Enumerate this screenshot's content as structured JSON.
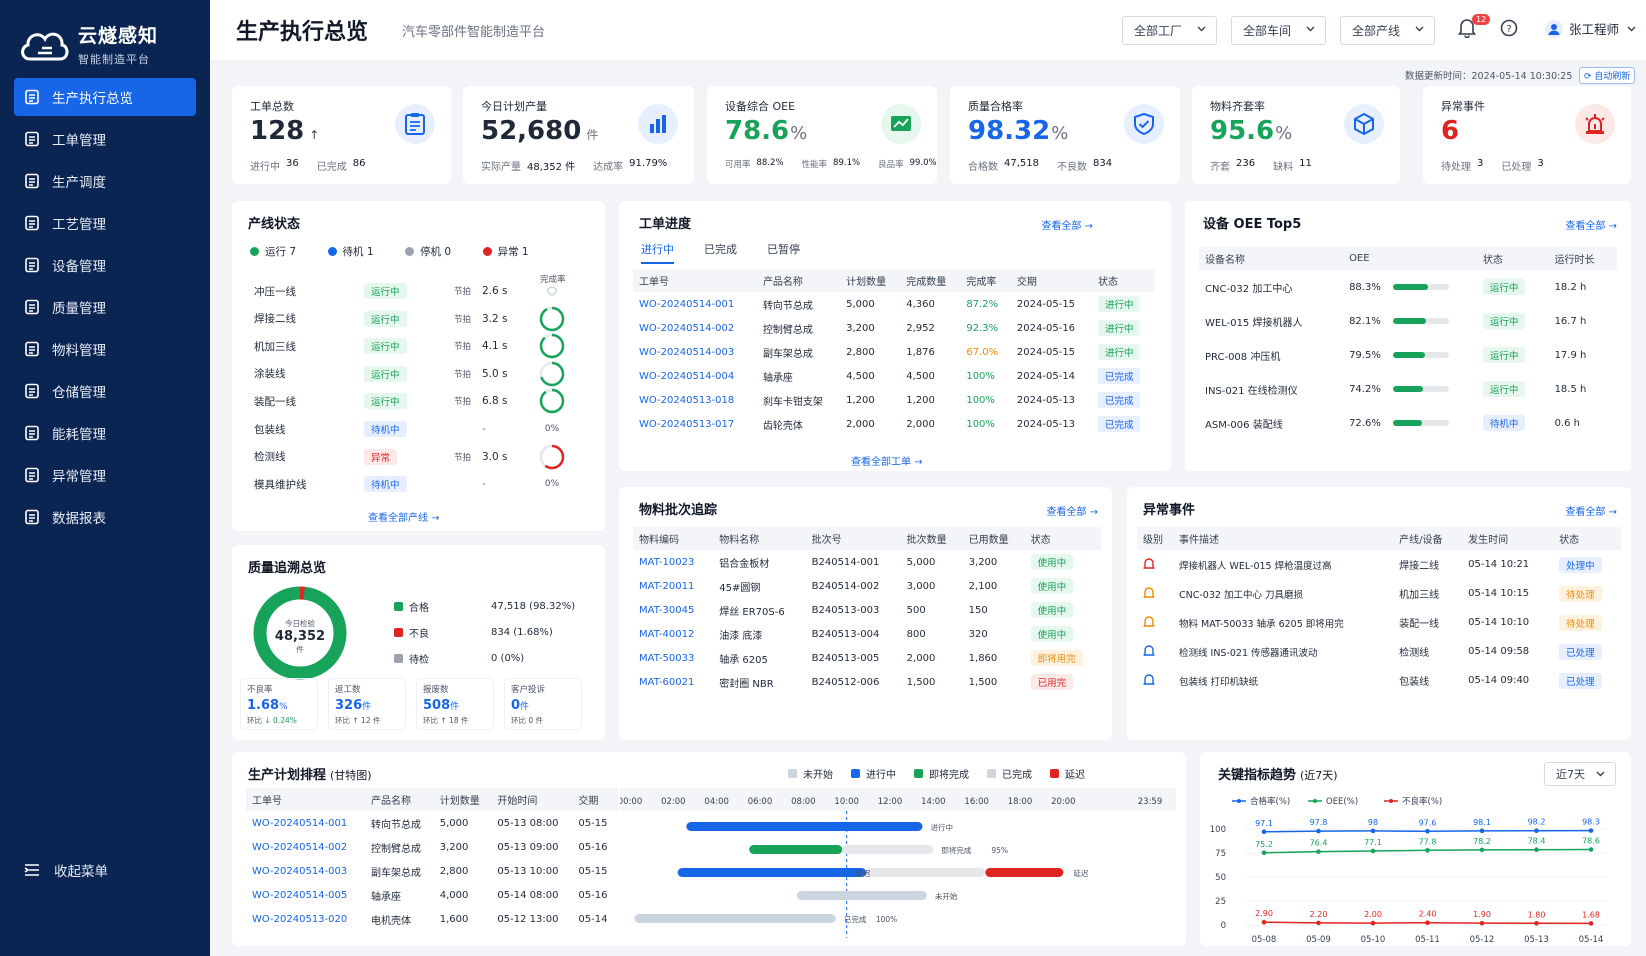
{
  "app": {
    "name": "云燧感知",
    "subtitle": "智能制造平台"
  },
  "nav": [
    {
      "label": "生产执行总览",
      "active": true
    },
    {
      "label": "工单管理"
    },
    {
      "label": "生产调度"
    },
    {
      "label": "工艺管理"
    },
    {
      "label": "设备管理"
    },
    {
      "label": "质量管理"
    },
    {
      "label": "物料管理"
    },
    {
      "label": "仓储管理"
    },
    {
      "label": "能耗管理"
    },
    {
      "label": "异常管理"
    },
    {
      "label": "数据报表"
    }
  ],
  "collapse_label": "收起菜单",
  "header": {
    "title": "生产执行总览",
    "subtitle": "汽车零部件智能制造平台",
    "factory": "全部工厂",
    "workshop": "全部车间",
    "line": "全部产线",
    "notif_count": "12",
    "user": "张工程师"
  },
  "meta": {
    "updated": "数据更新时间：2024-05-14 10:30:25",
    "auto": "自动刷新"
  },
  "kpis": {
    "orders": {
      "label": "工单总数",
      "value": "128",
      "sub1_l": "进行中",
      "sub1_v": "36",
      "sub2_l": "已完成",
      "sub2_v": "86"
    },
    "plan": {
      "label": "今日计划产量",
      "value": "52,680",
      "unit": "件",
      "sub1_l": "实际产量",
      "sub1_v": "48,352 件",
      "sub2_l": "达成率",
      "sub2_v": "91.79%"
    },
    "oee": {
      "label": "设备综合 OEE",
      "value": "78.6",
      "unit": "%",
      "sub1_l": "可用率",
      "sub1_v": "88.2%",
      "sub2_l": "性能率",
      "sub2_v": "89.1%",
      "sub3_l": "良品率",
      "sub3_v": "99.0%"
    },
    "quality": {
      "label": "质量合格率",
      "value": "98.32",
      "unit": "%",
      "sub1_l": "合格数",
      "sub1_v": "47,518",
      "sub2_l": "不良数",
      "sub2_v": "834"
    },
    "material": {
      "label": "物料齐套率",
      "value": "95.6",
      "unit": "%",
      "sub1_l": "齐套",
      "sub1_v": "236",
      "sub2_l": "缺料",
      "sub2_v": "11"
    },
    "abnormal": {
      "label": "异常事件",
      "value": "6",
      "sub1_l": "待处理",
      "sub1_v": "3",
      "sub2_l": "已处理",
      "sub2_v": "3"
    }
  },
  "line_status": {
    "title": "产线状态",
    "legend": [
      "运行 7",
      "待机 1",
      "停机 0",
      "异常 1"
    ],
    "rate_header": "完成率",
    "more": "查看全部产线",
    "rows": [
      {
        "name": "冲压一线",
        "status": "运行中",
        "cls": "p-run",
        "beat": "节拍",
        "sec": "2.6 s",
        "rate": "",
        "prog": 0
      },
      {
        "name": "焊接二线",
        "status": "运行中",
        "cls": "p-run",
        "beat": "节拍",
        "sec": "3.2 s",
        "rate": "",
        "prog": 0.92
      },
      {
        "name": "机加三线",
        "status": "运行中",
        "cls": "p-run",
        "beat": "节拍",
        "sec": "4.1 s",
        "rate": "",
        "prog": 0.88
      },
      {
        "name": "涂装线",
        "status": "运行中",
        "cls": "p-run",
        "beat": "节拍",
        "sec": "5.0 s",
        "rate": "",
        "prog": 0.7
      },
      {
        "name": "装配一线",
        "status": "运行中",
        "cls": "p-run",
        "beat": "节拍",
        "sec": "6.8 s",
        "rate": "",
        "prog": 0.9
      },
      {
        "name": "包装线",
        "status": "待机中",
        "cls": "p-wait",
        "beat": "",
        "sec": "-",
        "rate": "0%",
        "prog": -1
      },
      {
        "name": "检测线",
        "status": "异常",
        "cls": "p-err",
        "beat": "节拍",
        "sec": "3.0 s",
        "rate": "",
        "prog": 0.6
      },
      {
        "name": "模具维护线",
        "status": "待机中",
        "cls": "p-wait",
        "beat": "",
        "sec": "-",
        "rate": "0%",
        "prog": -1
      }
    ]
  },
  "orders": {
    "title": "工单进度",
    "more": "查看全部",
    "tabs": [
      "进行中",
      "已完成",
      "已暂停"
    ],
    "footer": "查看全部工单",
    "headers": [
      "工单号",
      "产品名称",
      "计划数量",
      "完成数量",
      "完成率",
      "交期",
      "状态"
    ],
    "rows": [
      [
        "WO-20240514-001",
        "转向节总成",
        "5,000",
        "4,360",
        "87.2%",
        "2024-05-15",
        "进行中"
      ],
      [
        "WO-20240514-002",
        "控制臂总成",
        "3,200",
        "2,952",
        "92.3%",
        "2024-05-16",
        "进行中"
      ],
      [
        "WO-20240514-003",
        "副车架总成",
        "2,800",
        "1,876",
        "67.0%",
        "2024-05-15",
        "进行中"
      ],
      [
        "WO-20240514-004",
        "轴承座",
        "4,500",
        "4,500",
        "100%",
        "2024-05-14",
        "已完成"
      ],
      [
        "WO-20240513-018",
        "刹车卡钳支架",
        "1,200",
        "1,200",
        "100%",
        "2024-05-13",
        "已完成"
      ],
      [
        "WO-20240513-017",
        "齿轮壳体",
        "2,000",
        "2,000",
        "100%",
        "2024-05-13",
        "已完成"
      ]
    ]
  },
  "oee_top": {
    "title": "设备 OEE Top5",
    "more": "查看全部",
    "headers": [
      "设备名称",
      "OEE",
      "状态",
      "运行时长"
    ],
    "rows": [
      {
        "name": "CNC-032 加工中心",
        "oee": "88.3%",
        "v": 0.883,
        "status": "运行中",
        "cls": "p-run",
        "hours": "18.2 h"
      },
      {
        "name": "WEL-015 焊接机器人",
        "oee": "82.1%",
        "v": 0.821,
        "status": "运行中",
        "cls": "p-run",
        "hours": "16.7 h"
      },
      {
        "name": "PRC-008 冲压机",
        "oee": "79.5%",
        "v": 0.795,
        "status": "运行中",
        "cls": "p-run",
        "hours": "17.9 h"
      },
      {
        "name": "INS-021 在线检测仪",
        "oee": "74.2%",
        "v": 0.742,
        "status": "运行中",
        "cls": "p-run",
        "hours": "18.5 h"
      },
      {
        "name": "ASM-006 装配线",
        "oee": "72.6%",
        "v": 0.726,
        "status": "待机中",
        "cls": "p-wait",
        "hours": "0.6 h"
      }
    ]
  },
  "quality_trace": {
    "title": "质量追溯总览",
    "center_label": "今日检验",
    "center_value": "48,352",
    "center_unit": "件",
    "legend": [
      {
        "name": "合格",
        "val": "47,518 (98.32%)",
        "color": "#17a35a"
      },
      {
        "name": "不良",
        "val": "834 (1.68%)",
        "color": "#e02424"
      },
      {
        "name": "待检",
        "val": "0 (0%)",
        "color": "#9ca3af"
      }
    ],
    "smalls": [
      {
        "l": "不良率",
        "v": "1.68",
        "u": "%",
        "s1": "环比",
        "s2": "↓ 0.24%"
      },
      {
        "l": "返工数",
        "v": "326",
        "u": "件",
        "s1": "环比",
        "s2": "↑ 12 件"
      },
      {
        "l": "报废数",
        "v": "508",
        "u": "件",
        "s1": "环比",
        "s2": "↑ 18 件"
      },
      {
        "l": "客户投诉",
        "v": "0",
        "u": "件",
        "s1": "环比",
        "s2": "0 件"
      }
    ]
  },
  "batch": {
    "title": "物料批次追踪",
    "more": "查看全部",
    "headers": [
      "物料编码",
      "物料名称",
      "批次号",
      "批次数量",
      "已用数量",
      "状态"
    ],
    "rows": [
      [
        "MAT-10023",
        "铝合金板材",
        "B240514-001",
        "5,000",
        "3,200",
        "使用中",
        "p-run"
      ],
      [
        "MAT-20011",
        "45#圆钢",
        "B240514-002",
        "3,000",
        "2,100",
        "使用中",
        "p-run"
      ],
      [
        "MAT-30045",
        "焊丝 ER70S-6",
        "B240513-003",
        "500",
        "150",
        "使用中",
        "p-run"
      ],
      [
        "MAT-40012",
        "油漆 底漆",
        "B240513-004",
        "800",
        "320",
        "使用中",
        "p-run"
      ],
      [
        "MAT-50033",
        "轴承 6205",
        "B240513-005",
        "2,000",
        "1,860",
        "即将用完",
        "p-warn"
      ],
      [
        "MAT-60021",
        "密封圈 NBR",
        "B240512-006",
        "1,500",
        "1,500",
        "已用完",
        "p-err"
      ]
    ]
  },
  "events": {
    "title": "异常事件",
    "more": "查看全部",
    "headers": [
      "级别",
      "事件描述",
      "产线/设备",
      "发生时间",
      "状态"
    ],
    "rows": [
      [
        "焊接机器人 WEL-015 焊枪温度过高",
        "焊接二线",
        "05-14 10:21",
        "处理中",
        "p-wait",
        "#e02424"
      ],
      [
        "CNC-032 加工中心 刀具磨损",
        "机加三线",
        "05-14 10:15",
        "待处理",
        "p-warn",
        "#f08c00"
      ],
      [
        "物料 MAT-50033 轴承 6205 即将用完",
        "装配一线",
        "05-14 10:10",
        "待处理",
        "p-warn",
        "#f08c00"
      ],
      [
        "检测线 INS-021 传感器通讯波动",
        "检测线",
        "05-14 09:58",
        "已处理",
        "p-wait",
        "#1766e8"
      ],
      [
        "包装线 打印机缺纸",
        "包装线",
        "05-14 09:40",
        "已处理",
        "p-wait",
        "#1766e8"
      ]
    ]
  },
  "gantt": {
    "title": "生产计划排程",
    "title2": "(甘特图)",
    "legend": [
      "未开始",
      "进行中",
      "即将完成",
      "已完成",
      "延迟"
    ],
    "headers": [
      "工单号",
      "产品名称",
      "计划数量",
      "开始时间",
      "交期"
    ],
    "times": [
      "00:00",
      "02:00",
      "04:00",
      "06:00",
      "08:00",
      "10:00",
      "12:00",
      "14:00",
      "16:00",
      "18:00",
      "20:00",
      "23:59"
    ],
    "rows": [
      {
        "id": "WO-20240514-001",
        "name": "转向节总成",
        "qty": "5,000",
        "start": "05-13 08:00",
        "due": "05-15",
        "label": "进行中",
        "pct": ""
      },
      {
        "id": "WO-20240514-002",
        "name": "控制臂总成",
        "qty": "3,200",
        "start": "05-13 09:00",
        "due": "05-16",
        "label": "即将完成",
        "pct": "95%"
      },
      {
        "id": "WO-20240514-003",
        "name": "副车架总成",
        "qty": "2,800",
        "start": "05-13 10:00",
        "due": "05-15",
        "label": "延迟",
        "pct": ""
      },
      {
        "id": "WO-20240514-005",
        "name": "轴承座",
        "qty": "4,000",
        "start": "05-14 08:00",
        "due": "05-16",
        "label": "未开始",
        "pct": ""
      },
      {
        "id": "WO-20240513-020",
        "name": "电机壳体",
        "qty": "1,600",
        "start": "05-12 13:00",
        "due": "05-14",
        "label": "已完成",
        "pct": "100%"
      }
    ],
    "mid_label": "延迟"
  },
  "trend": {
    "title": "关键指标趋势",
    "title2": "(近7天)",
    "range": "近7天",
    "legend": [
      "合格率(%)",
      "OEE(%)",
      "不良率(%)"
    ]
  },
  "chart_data": {
    "type": "line",
    "title": "关键指标趋势",
    "x": [
      "05-08",
      "05-09",
      "05-10",
      "05-11",
      "05-12",
      "05-13",
      "05-14"
    ],
    "ylim": [
      0,
      100
    ],
    "yticks": [
      0,
      25,
      50,
      75,
      100
    ],
    "series": [
      {
        "name": "合格率(%)",
        "values": [
          97.1,
          97.8,
          98.0,
          97.6,
          98.1,
          98.2,
          98.3
        ],
        "color": "#1766e8"
      },
      {
        "name": "OEE(%)",
        "values": [
          75.2,
          76.4,
          77.1,
          77.8,
          78.2,
          78.4,
          78.6
        ],
        "color": "#17a35a"
      },
      {
        "name": "不良率(%)",
        "values": [
          2.9,
          2.2,
          2.0,
          2.4,
          1.9,
          1.8,
          1.68
        ],
        "labels": [
          "2.90",
          "2.20",
          "2.00",
          "2.40",
          "1.90",
          "1.80",
          "1.68"
        ],
        "color": "#e02424"
      }
    ]
  }
}
